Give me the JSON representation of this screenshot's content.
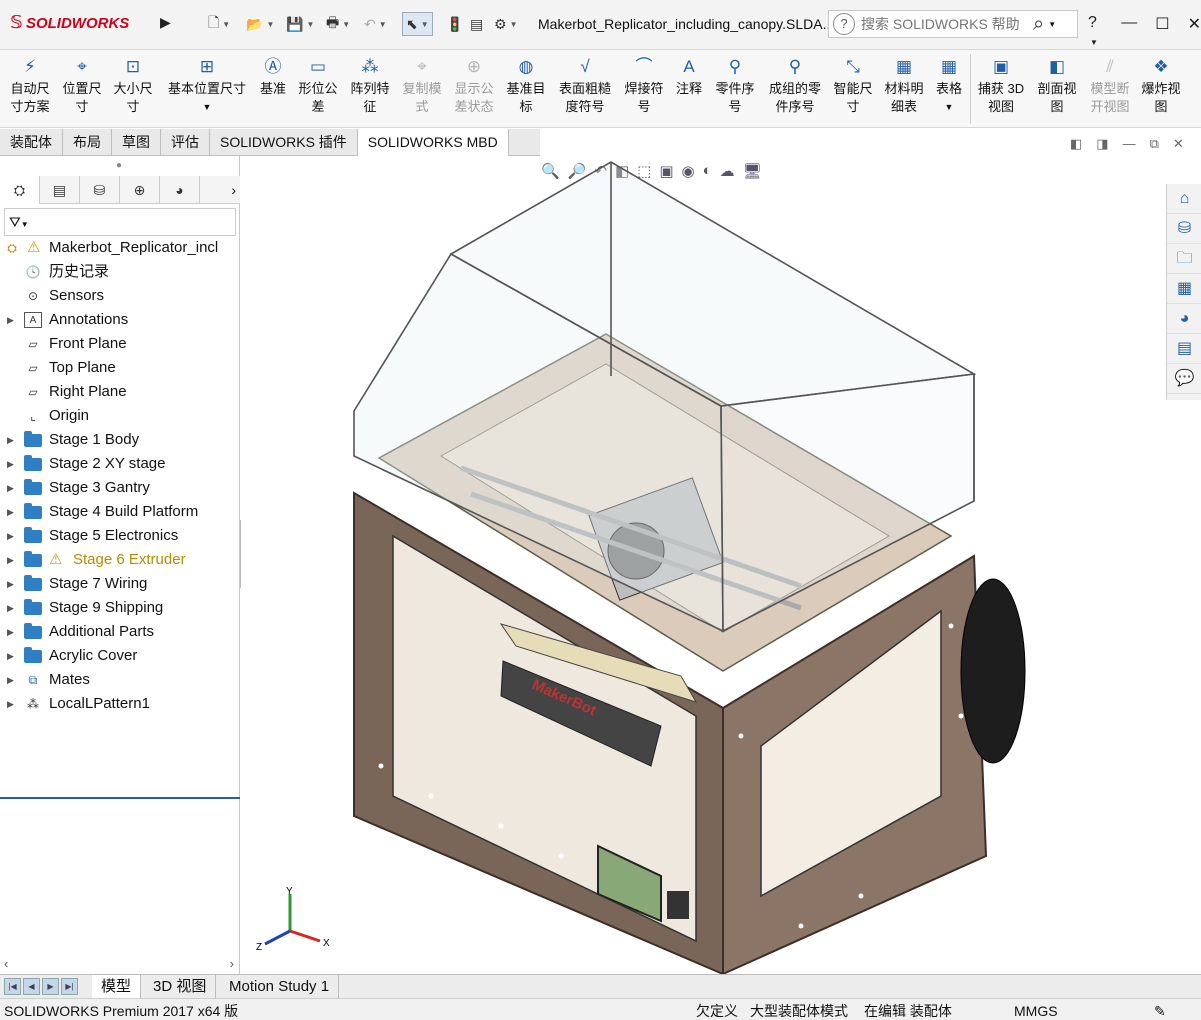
{
  "app": {
    "logo": "SOLIDWORKS",
    "document_title": "Makerbot_Replicator_including_canopy.SLDA...",
    "search_placeholder": "搜索 SOLIDWORKS 帮助",
    "help_label": "?"
  },
  "commands": [
    {
      "id": "auto-dimension-scheme",
      "label": "自动尺寸方案",
      "icon": "auto-dim-icon",
      "enabled": true
    },
    {
      "id": "location-dimension",
      "label": "位置尺寸",
      "icon": "location-dim-icon",
      "enabled": true
    },
    {
      "id": "size-dimension",
      "label": "大小尺寸",
      "icon": "size-dim-icon",
      "enabled": true
    },
    {
      "id": "basic-location-dimension",
      "label": "基本位置尺寸",
      "icon": "basic-location-dim-icon",
      "enabled": true
    },
    {
      "id": "datum",
      "label": "基准",
      "icon": "datum-icon",
      "enabled": true
    },
    {
      "id": "geometric-tolerance",
      "label": "形位公差",
      "icon": "geometric-tolerance-icon",
      "enabled": true
    },
    {
      "id": "pattern-feature",
      "label": "阵列特征",
      "icon": "pattern-feature-icon",
      "enabled": true
    },
    {
      "id": "copy-scheme",
      "label": "复制模式",
      "icon": "copy-scheme-icon",
      "enabled": false
    },
    {
      "id": "show-tolerance-status",
      "label": "显示公差状态",
      "icon": "tolerance-status-icon",
      "enabled": false
    },
    {
      "id": "datum-target",
      "label": "基准目标",
      "icon": "datum-target-icon",
      "enabled": true
    },
    {
      "id": "surface-finish",
      "label": "表面粗糙度符号",
      "icon": "surface-finish-icon",
      "enabled": true
    },
    {
      "id": "weld-symbol",
      "label": "焊接符号",
      "icon": "weld-symbol-icon",
      "enabled": true
    },
    {
      "id": "note",
      "label": "注释",
      "icon": "note-icon",
      "enabled": true
    },
    {
      "id": "balloon",
      "label": "零件序号",
      "icon": "balloon-icon",
      "enabled": true
    },
    {
      "id": "auto-balloon",
      "label": "成组的零件序号",
      "icon": "auto-balloon-icon",
      "enabled": true
    },
    {
      "id": "smart-dimension",
      "label": "智能尺寸",
      "icon": "smart-dimension-icon",
      "enabled": true
    },
    {
      "id": "bill-of-materials",
      "label": "材料明细表",
      "icon": "bom-icon",
      "enabled": true
    },
    {
      "id": "table",
      "label": "表格",
      "icon": "table-icon",
      "enabled": true
    },
    {
      "id": "capture-3d-view",
      "label": "捕获 3D 视图",
      "icon": "capture-3d-icon",
      "enabled": true
    },
    {
      "id": "section-view",
      "label": "剖面视图",
      "icon": "section-view-icon",
      "enabled": true
    },
    {
      "id": "model-break-view",
      "label": "模型断开视图",
      "icon": "model-break-icon",
      "enabled": false
    },
    {
      "id": "exploded-view",
      "label": "爆炸视图",
      "icon": "exploded-view-icon",
      "enabled": true
    }
  ],
  "command_tabs": [
    "装配体",
    "布局",
    "草图",
    "评估",
    "SOLIDWORKS 插件",
    "SOLIDWORKS MBD"
  ],
  "active_command_tab": "SOLIDWORKS MBD",
  "feature_tree": {
    "root": "Makerbot_Replicator_incl",
    "nodes": [
      {
        "label": "历史记录",
        "type": "history",
        "expandable": false
      },
      {
        "label": "Sensors",
        "type": "sensors",
        "expandable": false
      },
      {
        "label": "Annotations",
        "type": "annotations",
        "expandable": true
      },
      {
        "label": "Front Plane",
        "type": "plane",
        "expandable": false
      },
      {
        "label": "Top Plane",
        "type": "plane",
        "expandable": false
      },
      {
        "label": "Right Plane",
        "type": "plane",
        "expandable": false
      },
      {
        "label": "Origin",
        "type": "origin",
        "expandable": false
      },
      {
        "label": "Stage 1 Body",
        "type": "folder",
        "expandable": true
      },
      {
        "label": "Stage 2 XY stage",
        "type": "folder",
        "expandable": true
      },
      {
        "label": "Stage 3 Gantry",
        "type": "folder",
        "expandable": true
      },
      {
        "label": "Stage 4 Build Platform",
        "type": "folder",
        "expandable": true
      },
      {
        "label": "Stage 5 Electronics",
        "type": "folder",
        "expandable": true
      },
      {
        "label": "Stage 6 Extruder",
        "type": "folder",
        "expandable": true,
        "warning": true
      },
      {
        "label": "Stage 7 Wiring",
        "type": "folder",
        "expandable": true
      },
      {
        "label": "Stage 9 Shipping",
        "type": "folder",
        "expandable": true
      },
      {
        "label": "Additional Parts",
        "type": "folder",
        "expandable": true
      },
      {
        "label": "Acrylic Cover",
        "type": "folder",
        "expandable": true
      },
      {
        "label": "Mates",
        "type": "mates",
        "expandable": true
      },
      {
        "label": "LocalLPattern1",
        "type": "pattern",
        "expandable": true
      }
    ]
  },
  "bottom_tabs": [
    "模型",
    "3D 视图",
    "Motion Study 1"
  ],
  "active_bottom_tab": "模型",
  "status": {
    "product": "SOLIDWORKS Premium 2017 x64 版",
    "definition": "欠定义",
    "mode": "大型装配体模式",
    "editing": "在编辑 装配体",
    "units": "MMGS"
  },
  "triad_axes": [
    "Y",
    "Z",
    "X"
  ],
  "model_logo": "MakerBot",
  "colors": {
    "accent": "#1f5fa8",
    "logo_red": "#d0021b",
    "warning": "#d4a000",
    "folder_blue": "#2f7fc4",
    "wood": "#7a6658",
    "wood_light": "#d9c9b7"
  }
}
